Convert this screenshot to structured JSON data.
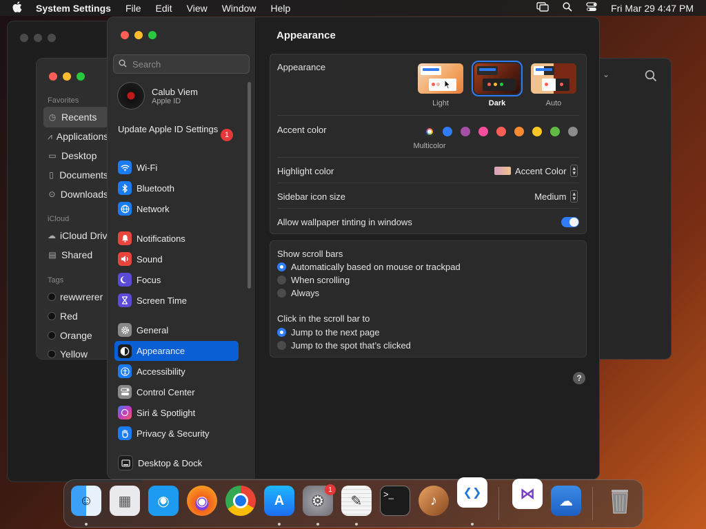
{
  "menubar": {
    "app_name": "System Settings",
    "items": [
      "File",
      "Edit",
      "View",
      "Window",
      "Help"
    ],
    "clock": "Fri Mar 29  4:47 PM"
  },
  "finder": {
    "favorites_header": "Favorites",
    "favorites": [
      "Recents",
      "Applications",
      "Desktop",
      "Documents",
      "Downloads"
    ],
    "icloud_header": "iCloud",
    "icloud": [
      "iCloud Drive",
      "Shared"
    ],
    "tags_header": "Tags",
    "tags": [
      {
        "label": "rewwrerer",
        "color": "#1a1a1a"
      },
      {
        "label": "Red",
        "color": "#1a1a1a"
      },
      {
        "label": "Orange",
        "color": "#1a1a1a"
      },
      {
        "label": "Yellow",
        "color": "#1a1a1a"
      }
    ]
  },
  "settings": {
    "search_placeholder": "Search",
    "user": {
      "name": "Calub Viem",
      "subtitle": "Apple ID"
    },
    "update": {
      "label": "Update Apple ID Settings",
      "badge": "1"
    },
    "sidebar": [
      {
        "label": "Wi-Fi",
        "icon": "wifi-icon",
        "color": "#1a7cf0"
      },
      {
        "label": "Bluetooth",
        "icon": "bluetooth-icon",
        "color": "#1a7cf0"
      },
      {
        "label": "Network",
        "icon": "globe-icon",
        "color": "#1a7cf0"
      },
      {
        "label": "Notifications",
        "icon": "bell-icon",
        "color": "#e8453c"
      },
      {
        "label": "Sound",
        "icon": "speaker-icon",
        "color": "#e8453c"
      },
      {
        "label": "Focus",
        "icon": "moon-icon",
        "color": "#5b4bd6"
      },
      {
        "label": "Screen Time",
        "icon": "hourglass-icon",
        "color": "#5b4bd6"
      },
      {
        "label": "General",
        "icon": "gear-icon",
        "color": "#8a8a8a"
      },
      {
        "label": "Appearance",
        "icon": "appearance-icon",
        "color": "#1c1c1c",
        "selected": true
      },
      {
        "label": "Accessibility",
        "icon": "accessibility-icon",
        "color": "#1a7cf0"
      },
      {
        "label": "Control Center",
        "icon": "control-center-icon",
        "color": "#8a8a8a"
      },
      {
        "label": "Siri & Spotlight",
        "icon": "siri-icon",
        "color": "#b03cc0"
      },
      {
        "label": "Privacy & Security",
        "icon": "hand-icon",
        "color": "#1a7cf0"
      },
      {
        "label": "Desktop & Dock",
        "icon": "dock-icon",
        "color": "#1c1c1c"
      }
    ]
  },
  "appearance": {
    "page_title": "Appearance",
    "appearance_label": "Appearance",
    "options": [
      {
        "label": "Light",
        "selected": false
      },
      {
        "label": "Dark",
        "selected": true
      },
      {
        "label": "Auto",
        "selected": false
      }
    ],
    "accent_label": "Accent color",
    "accent_colors": [
      "multicolor",
      "#2f7cf6",
      "#a550a7",
      "#f74f9e",
      "#fc5f55",
      "#fc8a2e",
      "#f8c725",
      "#62ba46",
      "#8c8c8c"
    ],
    "accent_selected_name": "Multicolor",
    "highlight_label": "Highlight color",
    "highlight_value": "Accent Color",
    "icon_size_label": "Sidebar icon size",
    "icon_size_value": "Medium",
    "tinting_label": "Allow wallpaper tinting in windows",
    "tinting_on": true,
    "scrollbars_label": "Show scroll bars",
    "scrollbar_options": [
      {
        "label": "Automatically based on mouse or trackpad",
        "selected": true
      },
      {
        "label": "When scrolling",
        "selected": false
      },
      {
        "label": "Always",
        "selected": false
      }
    ],
    "click_label": "Click in the scroll bar to",
    "click_options": [
      {
        "label": "Jump to the next page",
        "selected": true
      },
      {
        "label": "Jump to the spot that’s clicked",
        "selected": false
      }
    ],
    "help": "?"
  },
  "dock": {
    "apps": [
      {
        "name": "finder-icon",
        "color": "#2b8ef0",
        "glyph": "☺",
        "running": true
      },
      {
        "name": "launchpad-icon",
        "color": "#e9e9ee",
        "glyph": "▦",
        "running": false
      },
      {
        "name": "safari-icon",
        "color": "#1d9bf0",
        "glyph": "◎",
        "running": false
      },
      {
        "name": "firefox-icon",
        "color": "#f2611d",
        "glyph": "◉",
        "running": false
      },
      {
        "name": "chrome-icon",
        "color": "#e3e3e3",
        "glyph": "◍",
        "running": false
      },
      {
        "name": "app-store-icon",
        "color": "#1c8ef6",
        "glyph": "A",
        "running": true
      },
      {
        "name": "system-settings-icon",
        "color": "#8e8e93",
        "glyph": "⚙",
        "running": true,
        "badge": "1"
      },
      {
        "name": "textedit-icon",
        "color": "#f4f4f4",
        "glyph": "✎",
        "running": true
      },
      {
        "name": "terminal-icon",
        "color": "#1b1b1b",
        "glyph": ">_",
        "running": false
      },
      {
        "name": "garageband-icon",
        "color": "#b8753a",
        "glyph": "♪",
        "running": false
      },
      {
        "name": "vscode-icon",
        "color": "#ffffff",
        "glyph": "❮❯",
        "running": true
      },
      {
        "name": "visual-studio-icon",
        "color": "#ffffff",
        "glyph": "⋈",
        "running": false
      },
      {
        "name": "weather-icon",
        "color": "#2a7ad6",
        "glyph": "☁",
        "running": false
      },
      {
        "name": "trash-icon",
        "color": "#6a6a6a",
        "glyph": "🗑",
        "running": false
      }
    ]
  }
}
